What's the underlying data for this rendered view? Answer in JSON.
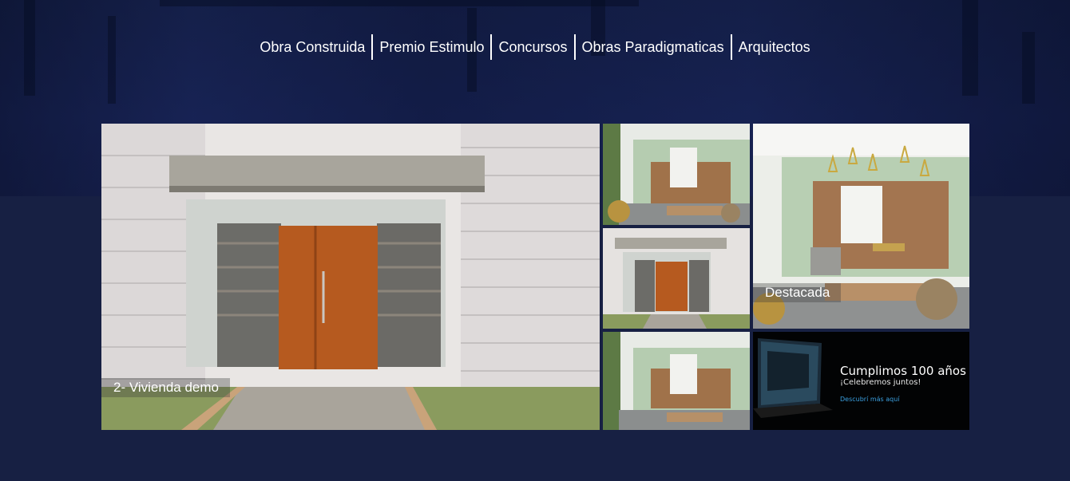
{
  "nav": {
    "items": [
      {
        "label": "Obra Construida"
      },
      {
        "label": "Premio Estimulo"
      },
      {
        "label": "Concursos"
      },
      {
        "label": "Obras Paradigmaticas"
      },
      {
        "label": "Arquitectos"
      }
    ]
  },
  "gallery": {
    "main": {
      "caption": "2- Vivienda demo"
    },
    "featured": {
      "caption": "Destacada"
    },
    "promo": {
      "title": "Cumplimos 100 años",
      "subtitle": "¡Celebremos juntos!",
      "link": "Descubrí más aquí"
    }
  },
  "colors": {
    "background": "#172043",
    "header_band": "#18245a",
    "nav_text": "#ffffff",
    "promo_link": "#3ba0e0"
  }
}
